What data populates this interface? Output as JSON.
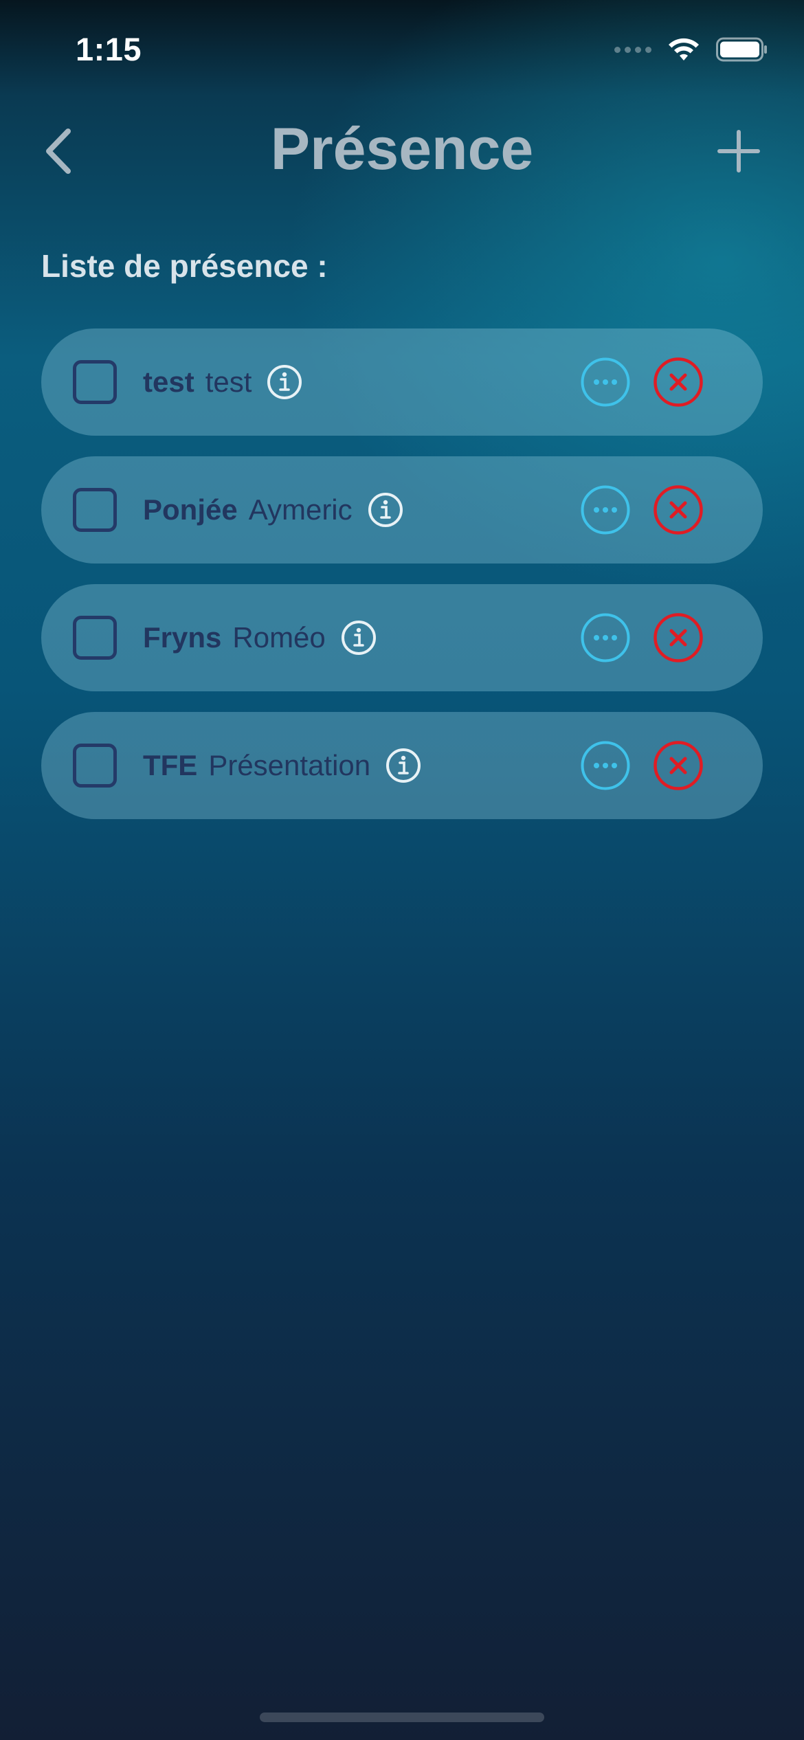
{
  "status_bar": {
    "time": "1:15"
  },
  "nav": {
    "title": "Présence",
    "back_icon": "chevron-left-icon",
    "add_icon": "plus-icon"
  },
  "section_label": "Liste de présence :",
  "attendees": [
    {
      "last": "test",
      "first": "test"
    },
    {
      "last": "Ponjée",
      "first": "Aymeric"
    },
    {
      "last": "Fryns",
      "first": "Roméo"
    },
    {
      "last": "TFE",
      "first": "Présentation"
    }
  ],
  "colors": {
    "accent_more": "#3fc2ea",
    "accent_delete": "#e01c24",
    "title": "#a7b7c2",
    "row_text": "#22365f"
  }
}
